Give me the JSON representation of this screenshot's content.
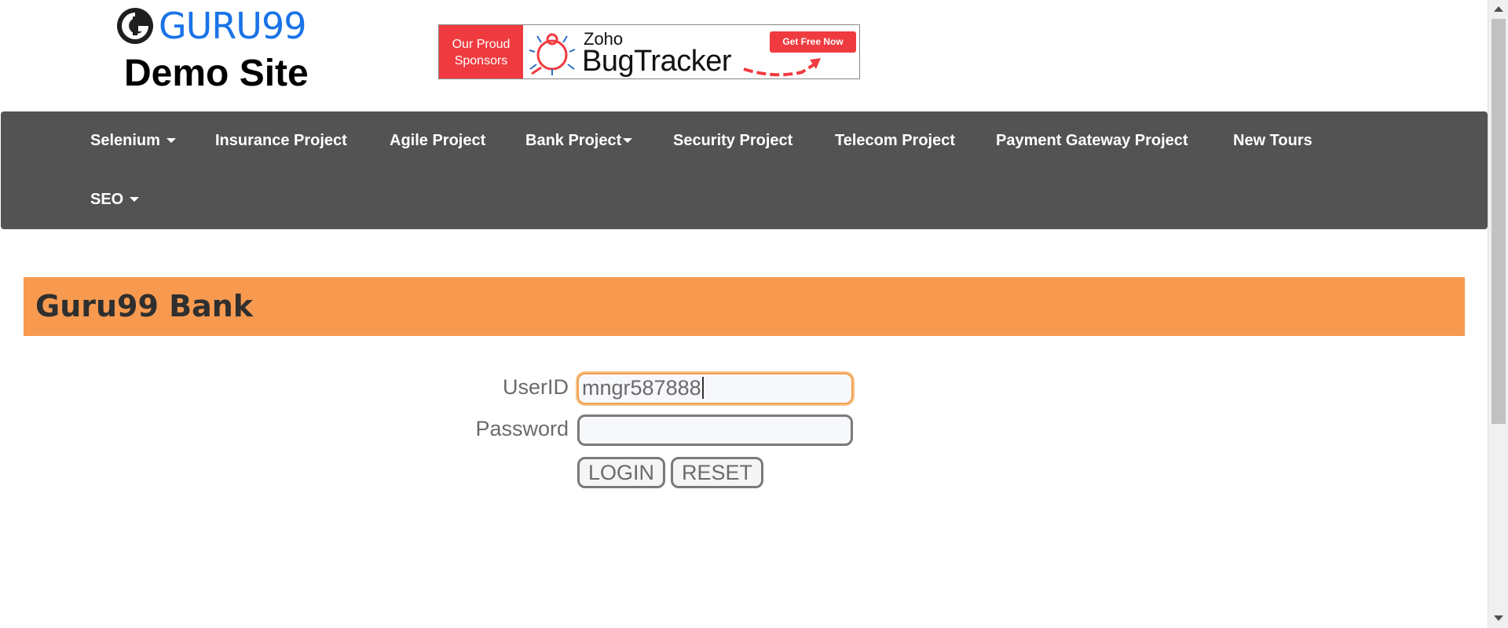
{
  "header": {
    "logo_text": "GURU99",
    "subtitle": "Demo Site",
    "logo_icon": "guru99-logo-icon"
  },
  "sponsor": {
    "left_line1": "Our Proud",
    "left_line2": "Sponsors",
    "brand_top": "Zoho",
    "brand_main": "BugTracker",
    "cta": "Get Free Now",
    "icon": "bug-icon",
    "colors": {
      "accent": "#ef3b40"
    }
  },
  "nav": {
    "items": [
      {
        "label": "Selenium",
        "dropdown": true
      },
      {
        "label": "Insurance Project",
        "dropdown": false
      },
      {
        "label": "Agile Project",
        "dropdown": false
      },
      {
        "label": "Bank Project",
        "dropdown": true
      },
      {
        "label": "Security Project",
        "dropdown": false
      },
      {
        "label": "Telecom Project",
        "dropdown": false
      },
      {
        "label": "Payment Gateway Project",
        "dropdown": false
      },
      {
        "label": "New Tours",
        "dropdown": false
      },
      {
        "label": "SEO",
        "dropdown": true
      }
    ],
    "colors": {
      "background": "#535353",
      "text": "#ffffff"
    }
  },
  "bank": {
    "title": "Guru99 Bank",
    "colors": {
      "bar": "#f79a50"
    }
  },
  "login_form": {
    "userid_label": "UserID",
    "userid_value": "mngr587888",
    "password_label": "Password",
    "password_value": "",
    "login_button": "LOGIN",
    "reset_button": "RESET"
  }
}
